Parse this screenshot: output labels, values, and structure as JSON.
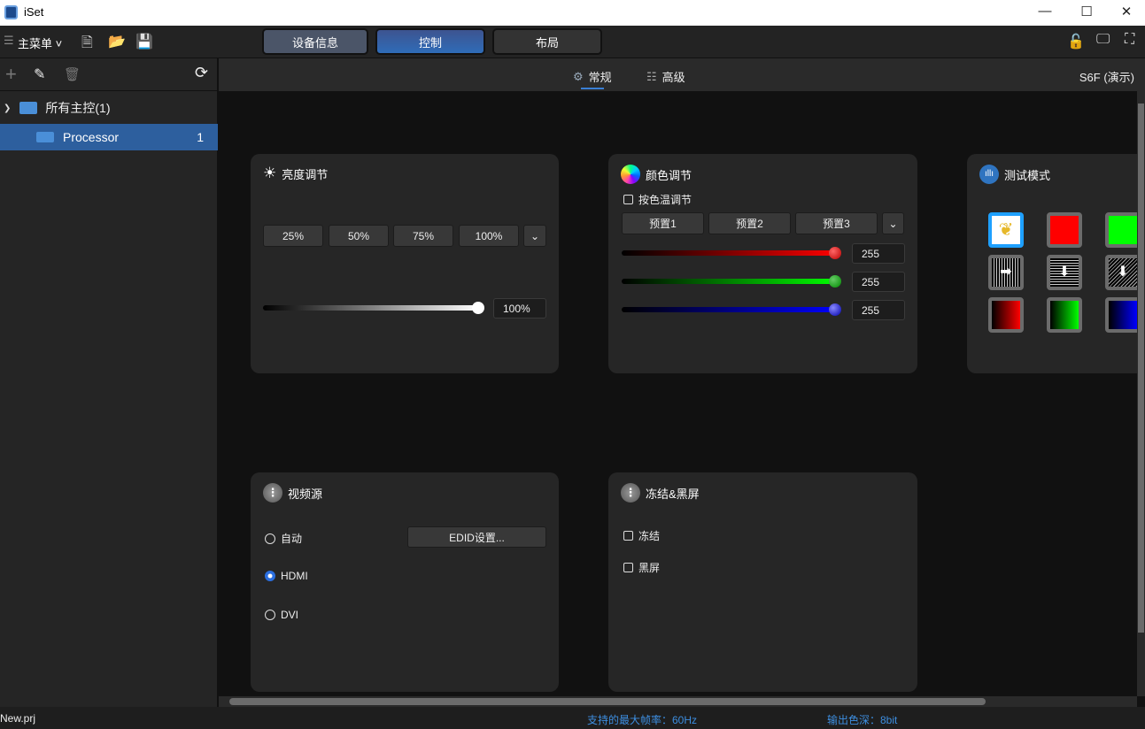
{
  "window": {
    "title": "iSet"
  },
  "toolbar": {
    "main_menu": "主菜单",
    "nav": [
      "设备信息",
      "控制",
      "布局"
    ]
  },
  "sidebar": {
    "root": "所有主控(1)",
    "device": "Processor",
    "device_count": "1"
  },
  "tabs": {
    "general": "常规",
    "advanced": "高级",
    "device_label": "S6F (演示)"
  },
  "brightness": {
    "title": "亮度调节",
    "presets": [
      "25%",
      "50%",
      "75%",
      "100%"
    ],
    "value": "100%",
    "level": 100
  },
  "color": {
    "title": "颜色调节",
    "temp_checkbox": "按色温调节",
    "presets": [
      "预置1",
      "预置2",
      "预置3"
    ],
    "red": "255",
    "green": "255",
    "blue": "255"
  },
  "test": {
    "title": "测试模式"
  },
  "video": {
    "title": "视频源",
    "options": [
      "自动",
      "HDMI",
      "DVI"
    ],
    "selected": "HDMI",
    "edid": "EDID设置..."
  },
  "freeze": {
    "title": "冻结&黑屏",
    "freeze": "冻结",
    "black": "黑屏"
  },
  "status": {
    "file": "New.prj",
    "max_rate": "支持的最大帧率：60Hz",
    "color_depth": "输出色深：8bit"
  },
  "colors": {
    "accent": "#2d5f9e",
    "active_tab": "#2f62a8"
  }
}
